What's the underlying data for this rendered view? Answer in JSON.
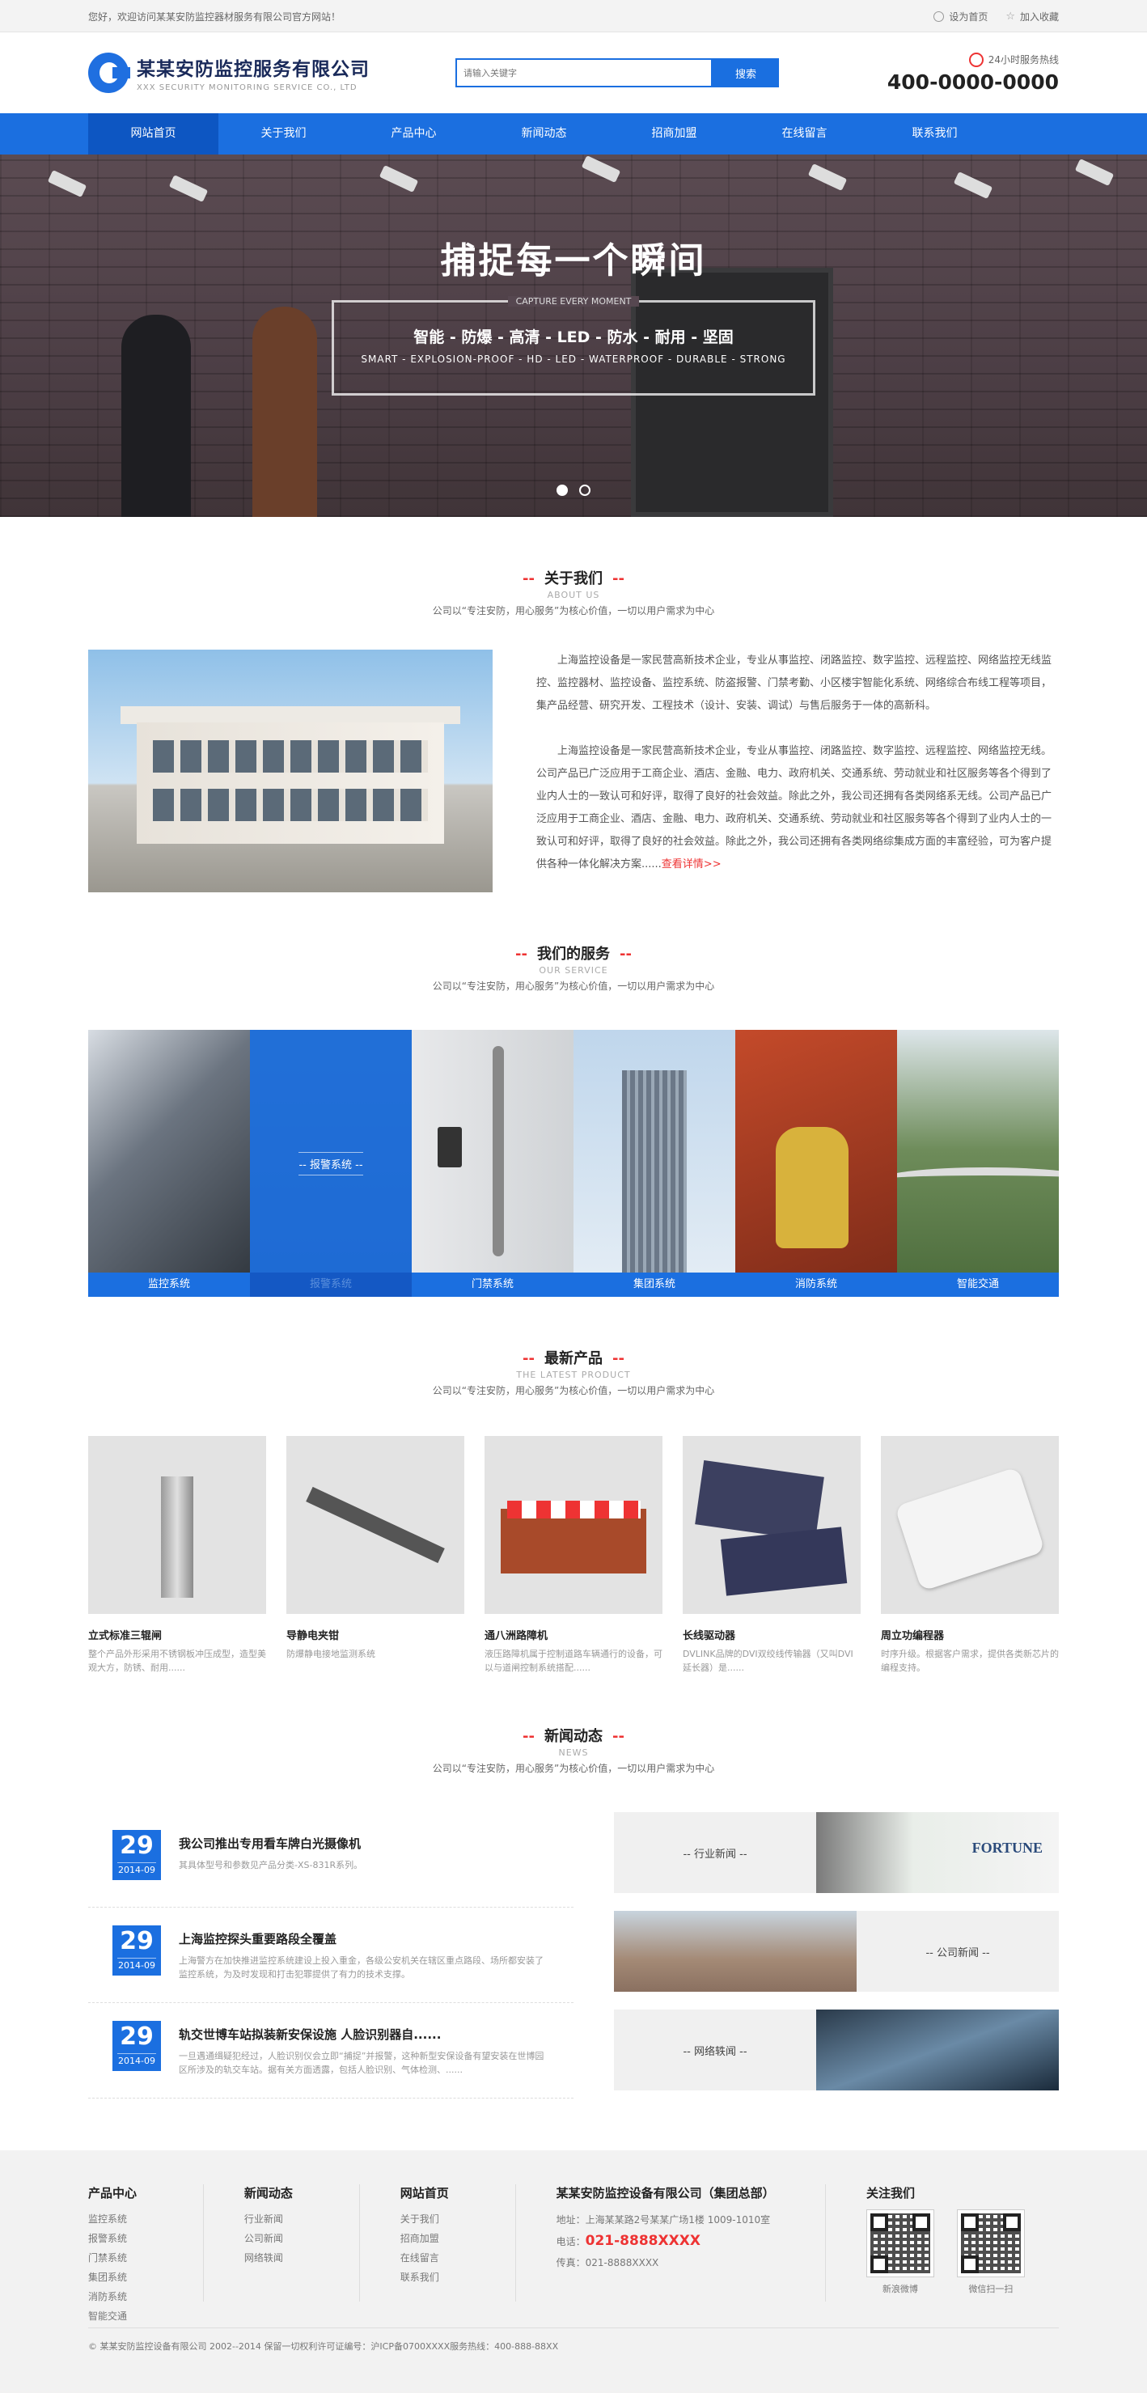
{
  "topbar": {
    "welcome": "您好，欢迎访问某某安防监控器材服务有限公司官方网站！",
    "set_home": "设为首页",
    "bookmark": "加入收藏"
  },
  "header": {
    "company_name": "某某安防监控服务有限公司",
    "company_en": "XXX SECURITY MONITORING SERVICE CO., LTD",
    "search_placeholder": "请输入关键字",
    "search_button": "搜索",
    "hotline_label": "24小时服务热线",
    "hotline_number": "400-0000-0000"
  },
  "nav": {
    "items": [
      "网站首页",
      "关于我们",
      "产品中心",
      "新闻动态",
      "招商加盟",
      "在线留言",
      "联系我们"
    ]
  },
  "banner": {
    "title": "捕捉每一个瞬间",
    "en": "CAPTURE EVERY MOMENT",
    "subtitle": "智能 - 防爆 - 高清 - LED - 防水 - 耐用 - 坚固",
    "subtitle_en": "SMART - EXPLOSION-PROOF - HD - LED - WATERPROOF - DURABLE - STRONG"
  },
  "sections": {
    "dash": "--",
    "desc": "公司以“专注安防，用心服务”为核心价值，一切以用户需求为中心",
    "about_title": "关于我们",
    "about_en": "ABOUT US",
    "service_title": "我们的服务",
    "service_en": "OUR SERVICE",
    "product_title": "最新产品",
    "product_en": "THE LATEST PRODUCT",
    "news_title": "新闻动态",
    "news_en": "NEWS"
  },
  "about": {
    "p1": "上海监控设备是一家民营高新技术企业，专业从事监控、闭路监控、数字监控、远程监控、网络监控无线监控、监控器材、监控设备、监控系统、防盗报警、门禁考勤、小区楼宇智能化系统、网络综合布线工程等项目，集产品经营、研究开发、工程技术（设计、安装、调试）与售后服务于一体的高新科。",
    "p2": "上海监控设备是一家民营高新技术企业，专业从事监控、闭路监控、数字监控、远程监控、网络监控无线。公司产品已广泛应用于工商企业、酒店、金融、电力、政府机关、交通系统、劳动就业和社区服务等各个得到了业内人士的一致认可和好评，取得了良好的社会效益。除此之外，我公司还拥有各类网络系无线。公司产品已广泛应用于工商企业、酒店、金融、电力、政府机关、交通系统、劳动就业和社区服务等各个得到了业内人士的一致认可和好评，取得了良好的社会效益。除此之外，我公司还拥有各类网络综集成方面的丰富经验，可为客户提供各种一体化解决方案......",
    "more": "查看详情>>"
  },
  "services": {
    "items": [
      "监控系统",
      "报警系统",
      "门禁系统",
      "集团系统",
      "消防系统",
      "智能交通"
    ],
    "hover_label": "-- 报警系统 --"
  },
  "products": [
    {
      "name": "立式标准三辊闸",
      "intro": "整个产品外形采用不锈钢板冲压成型，造型美观大方，防锈、耐用......"
    },
    {
      "name": "导静电夹钳",
      "intro": "防爆静电接地监测系统"
    },
    {
      "name": "通八洲路障机",
      "intro": "液压路障机属于控制道路车辆通行的设备，可以与道闸控制系统搭配......"
    },
    {
      "name": "长线驱动器",
      "intro": "DVLINK品牌的DVI双绞线传输器（又叫DVI延长器）是......"
    },
    {
      "name": "周立功编程器",
      "intro": "时序升级。根据客户需求，提供各类新芯片的编程支持。"
    }
  ],
  "news": {
    "items": [
      {
        "day": "29",
        "ym": "2014-09",
        "title": "我公司推出专用看车牌白光摄像机",
        "summary": "其具体型号和参数见产品分类-XS-831R系列。"
      },
      {
        "day": "29",
        "ym": "2014-09",
        "title": "上海监控探头重要路段全覆盖",
        "summary": "上海警方在加快推进监控系统建设上投入重金，各级公安机关在辖区重点路段、场所都安装了监控系统，为及时发现和打击犯罪提供了有力的技术支撑。"
      },
      {
        "day": "29",
        "ym": "2014-09",
        "title": "轨交世博车站拟装新安保设施 人脸识别器自......",
        "summary": "一旦遇通缉疑犯经过，人脸识别仪会立即“捕捉”并报警，这种新型安保设备有望安装在世博园区所涉及的轨交车站。据有关方面透露，包括人脸识别、气体检测、......"
      }
    ],
    "categories": [
      "-- 行业新闻 --",
      "-- 公司新闻 --",
      "-- 网络轶闻 --"
    ],
    "sign_text": "FORTUNE"
  },
  "footer": {
    "col1_title": "产品中心",
    "col1": [
      "监控系统",
      "报警系统",
      "门禁系统",
      "集团系统",
      "消防系统",
      "智能交通"
    ],
    "col2_title": "新闻动态",
    "col2": [
      "行业新闻",
      "公司新闻",
      "网络轶闻"
    ],
    "col3_title": "网站首页",
    "col3": [
      "关于我们",
      "招商加盟",
      "在线留言",
      "联系我们"
    ],
    "company": "某某安防监控设备有限公司（集团总部）",
    "address": "地址：上海某某路2号某某广场1楼 1009-1010室",
    "tel_label": "电话：",
    "tel": "021-8888XXXX",
    "fax": "传真：021-8888XXXX",
    "follow_title": "关注我们",
    "qr1": "新浪微博",
    "qr2": "微信扫一扫",
    "copyright": "© 某某安防监控设备有限公司 2002--2014 保留一切权利许可证编号：沪ICP备0700XXXX服务热线：400-888-88XX"
  },
  "colors": {
    "brand": "#1b6fe0",
    "accent": "#e33333"
  }
}
